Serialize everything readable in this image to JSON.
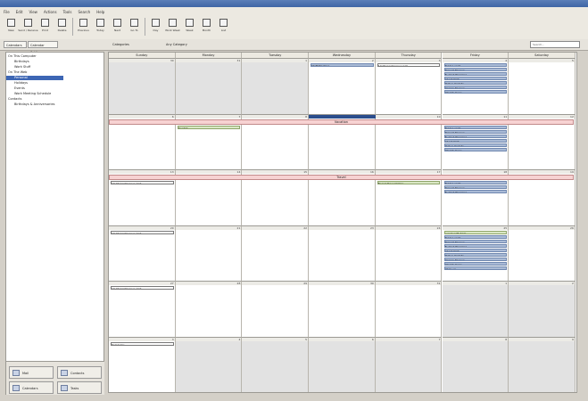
{
  "menu": [
    "File",
    "Edit",
    "View",
    "Actions",
    "Tools",
    "Search",
    "Help"
  ],
  "toolbar": [
    {
      "label": "New",
      "icon": "new-icon"
    },
    {
      "label": "Send / Receive",
      "icon": "send-receive-icon"
    },
    {
      "label": "Print",
      "icon": "print-icon"
    },
    {
      "label": "Delete",
      "icon": "delete-icon"
    },
    {
      "label": "Previous",
      "icon": "previous-icon"
    },
    {
      "label": "Today",
      "icon": "today-icon"
    },
    {
      "label": "Next",
      "icon": "next-icon"
    },
    {
      "label": "Go To",
      "icon": "go-to-icon"
    },
    {
      "label": "Day",
      "icon": "day-view-icon"
    },
    {
      "label": "Work Week",
      "icon": "work-week-icon"
    },
    {
      "label": "Week",
      "icon": "week-view-icon"
    },
    {
      "label": "Month",
      "icon": "month-view-icon"
    },
    {
      "label": "List",
      "icon": "list-view-icon"
    }
  ],
  "subbar": {
    "tab_calendars": "Calendars",
    "tab_settings": "Calendar Settings",
    "view_label": "Categories",
    "view_value": "Any Category",
    "search_placeholder": "Search..."
  },
  "sidebar": {
    "tree": [
      {
        "label": "On This Computer",
        "indent": 0
      },
      {
        "label": "Birthdays",
        "indent": 1
      },
      {
        "label": "Work Stuff",
        "indent": 1
      },
      {
        "label": "On The Web",
        "indent": 0
      },
      {
        "label": "Personal",
        "indent": 1,
        "selected": true
      },
      {
        "label": "Holidays",
        "indent": 1
      },
      {
        "label": "Events",
        "indent": 1
      },
      {
        "label": "Work Meeting Schedule",
        "indent": 1
      },
      {
        "label": "Contacts",
        "indent": 0
      },
      {
        "label": "Birthdays & Anniversaries",
        "indent": 1
      }
    ],
    "buttons": [
      "Mail",
      "Contacts",
      "Calendars",
      "Tasks"
    ]
  },
  "calendar": {
    "days": [
      "Sunday",
      "Monday",
      "Tuesday",
      "Wednesday",
      "Thursday",
      "Friday",
      "Saturday"
    ],
    "weeks": [
      {
        "dates": [
          "30",
          "31",
          "1",
          "2",
          "3",
          "4",
          "5"
        ],
        "other": [
          true,
          true,
          true,
          false,
          false,
          false,
          false
        ]
      },
      {
        "dates": [
          "6",
          "7",
          "8",
          "9",
          "10",
          "11",
          "12"
        ],
        "other": [
          false,
          false,
          false,
          false,
          false,
          false,
          false
        ]
      },
      {
        "dates": [
          "13",
          "14",
          "15",
          "16",
          "17",
          "18",
          "19"
        ],
        "other": [
          false,
          false,
          false,
          false,
          false,
          false,
          false
        ]
      },
      {
        "dates": [
          "20",
          "21",
          "22",
          "23",
          "24",
          "25",
          "26"
        ],
        "other": [
          false,
          false,
          false,
          false,
          false,
          false,
          false
        ]
      },
      {
        "dates": [
          "27",
          "28",
          "29",
          "30",
          "31",
          "1",
          "2"
        ],
        "other": [
          false,
          false,
          false,
          false,
          false,
          true,
          true
        ]
      },
      {
        "dates": [
          "3",
          "4",
          "5",
          "6",
          "7",
          "8",
          "9"
        ],
        "other": [
          false,
          true,
          true,
          true,
          true,
          true,
          true
        ]
      }
    ],
    "banners": [
      {
        "week": 1,
        "label": "Vacation"
      },
      {
        "week": 2,
        "label": "Travel"
      }
    ],
    "events": [
      {
        "week": 0,
        "day": 3,
        "row": 0,
        "color": "blue",
        "label": "Staff Meeting"
      },
      {
        "week": 0,
        "day": 4,
        "row": 0,
        "color": "white",
        "label": "10:00 Conference Call"
      },
      {
        "week": 0,
        "day": 5,
        "row": 0,
        "color": "blue",
        "label": "Team Lunch"
      },
      {
        "week": 0,
        "day": 5,
        "row": 1,
        "color": "blue",
        "label": "Project Review"
      },
      {
        "week": 0,
        "day": 5,
        "row": 2,
        "color": "blue",
        "label": "Budget Planning"
      },
      {
        "week": 0,
        "day": 5,
        "row": 3,
        "color": "blue",
        "label": "Client Visit"
      },
      {
        "week": 0,
        "day": 5,
        "row": 4,
        "color": "blue",
        "label": "Status Update"
      },
      {
        "week": 0,
        "day": 5,
        "row": 5,
        "color": "blue",
        "label": "Design Review"
      },
      {
        "week": 0,
        "day": 5,
        "row": 6,
        "color": "blue",
        "label": "Weekly Sync"
      },
      {
        "week": 1,
        "day": 1,
        "row": 0,
        "color": "green",
        "label": "Dentist"
      },
      {
        "week": 1,
        "day": 5,
        "row": 0,
        "color": "blue",
        "label": "Team Lunch"
      },
      {
        "week": 1,
        "day": 5,
        "row": 1,
        "color": "blue",
        "label": "Project Review"
      },
      {
        "week": 1,
        "day": 5,
        "row": 2,
        "color": "blue",
        "label": "Budget Planning"
      },
      {
        "week": 1,
        "day": 5,
        "row": 3,
        "color": "blue",
        "label": "Client Visit"
      },
      {
        "week": 1,
        "day": 5,
        "row": 4,
        "color": "blue",
        "label": "Status Update"
      },
      {
        "week": 1,
        "day": 5,
        "row": 5,
        "color": "blue",
        "label": "Weekly Sync"
      },
      {
        "week": 2,
        "day": 0,
        "row": 0,
        "color": "white",
        "label": "10:00 Conference Call"
      },
      {
        "week": 2,
        "day": 4,
        "row": 0,
        "color": "green",
        "label": "Board Presentation"
      },
      {
        "week": 2,
        "day": 5,
        "row": 0,
        "color": "blue",
        "label": "Team Lunch"
      },
      {
        "week": 2,
        "day": 5,
        "row": 1,
        "color": "blue",
        "label": "Project Review"
      },
      {
        "week": 2,
        "day": 5,
        "row": 2,
        "color": "blue",
        "label": "Budget Planning"
      },
      {
        "week": 3,
        "day": 0,
        "row": 0,
        "color": "white",
        "label": "10:00 Conference Call"
      },
      {
        "week": 3,
        "day": 5,
        "row": 0,
        "color": "green",
        "label": "Lunch with Sam"
      },
      {
        "week": 3,
        "day": 5,
        "row": 1,
        "color": "blue",
        "label": "Team Lunch"
      },
      {
        "week": 3,
        "day": 5,
        "row": 2,
        "color": "blue",
        "label": "Project Review"
      },
      {
        "week": 3,
        "day": 5,
        "row": 3,
        "color": "blue",
        "label": "Budget Planning"
      },
      {
        "week": 3,
        "day": 5,
        "row": 4,
        "color": "blue",
        "label": "Client Visit"
      },
      {
        "week": 3,
        "day": 5,
        "row": 5,
        "color": "blue",
        "label": "Status Update"
      },
      {
        "week": 3,
        "day": 5,
        "row": 6,
        "color": "blue",
        "label": "Design Review"
      },
      {
        "week": 3,
        "day": 5,
        "row": 7,
        "color": "blue",
        "label": "Weekly Sync"
      },
      {
        "week": 3,
        "day": 5,
        "row": 8,
        "color": "blue",
        "label": "Wrap-up"
      },
      {
        "week": 4,
        "day": 0,
        "row": 0,
        "color": "white",
        "label": "10:00 Conference Call"
      },
      {
        "week": 5,
        "day": 0,
        "row": 0,
        "color": "white",
        "label": "Reminder"
      }
    ],
    "wed_highlight_week": 1
  }
}
